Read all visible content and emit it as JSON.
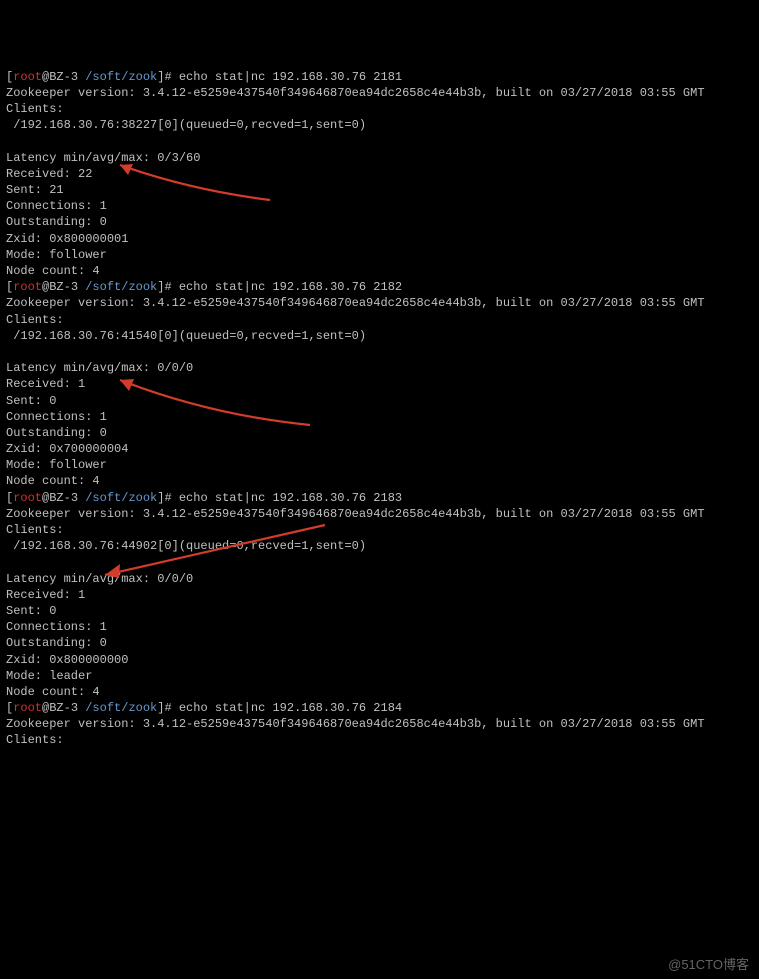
{
  "prompt": {
    "user": "root",
    "at": "@",
    "host": "BZ-3",
    "path": "/soft/zook",
    "open": "[",
    "close": "]#"
  },
  "blocks": [
    {
      "cmd": "echo stat|nc 192.168.30.76 2181",
      "version": "Zookeeper version: 3.4.12-e5259e437540f349646870ea94dc2658c4e44b3b, built on 03/27/2018 03:55 GMT",
      "clients_hdr": "Clients:",
      "client": " /192.168.30.76:38227[0](queued=0,recved=1,sent=0)",
      "latency": "Latency min/avg/max: 0/3/60",
      "received": "Received: 22",
      "sent": "Sent: 21",
      "connections": "Connections: 1",
      "outstanding": "Outstanding: 0",
      "zxid": "Zxid: 0x800000001",
      "mode": "Mode: follower",
      "nodecount": "Node count: 4"
    },
    {
      "cmd": "echo stat|nc 192.168.30.76 2182",
      "version": "Zookeeper version: 3.4.12-e5259e437540f349646870ea94dc2658c4e44b3b, built on 03/27/2018 03:55 GMT",
      "clients_hdr": "Clients:",
      "client": " /192.168.30.76:41540[0](queued=0,recved=1,sent=0)",
      "latency": "Latency min/avg/max: 0/0/0",
      "received": "Received: 1",
      "sent": "Sent: 0",
      "connections": "Connections: 1",
      "outstanding": "Outstanding: 0",
      "zxid": "Zxid: 0x700000004",
      "mode": "Mode: follower",
      "nodecount": "Node count: 4"
    },
    {
      "cmd": "echo stat|nc 192.168.30.76 2183",
      "version": "Zookeeper version: 3.4.12-e5259e437540f349646870ea94dc2658c4e44b3b, built on 03/27/2018 03:55 GMT",
      "clients_hdr": "Clients:",
      "client": " /192.168.30.76:44902[0](queued=0,recved=1,sent=0)",
      "latency": "Latency min/avg/max: 0/0/0",
      "received": "Received: 1",
      "sent": "Sent: 0",
      "connections": "Connections: 1",
      "outstanding": "Outstanding: 0",
      "zxid": "Zxid: 0x800000000",
      "mode": "Mode: leader",
      "nodecount": "Node count: 4"
    }
  ],
  "tail": {
    "cmd": "echo stat|nc 192.168.30.76 2184",
    "version": "Zookeeper version: 3.4.12-e5259e437540f349646870ea94dc2658c4e44b3b, built on 03/27/2018 03:55 GMT",
    "clients_hdr": "Clients:"
  },
  "watermark": "@51CTO博客"
}
